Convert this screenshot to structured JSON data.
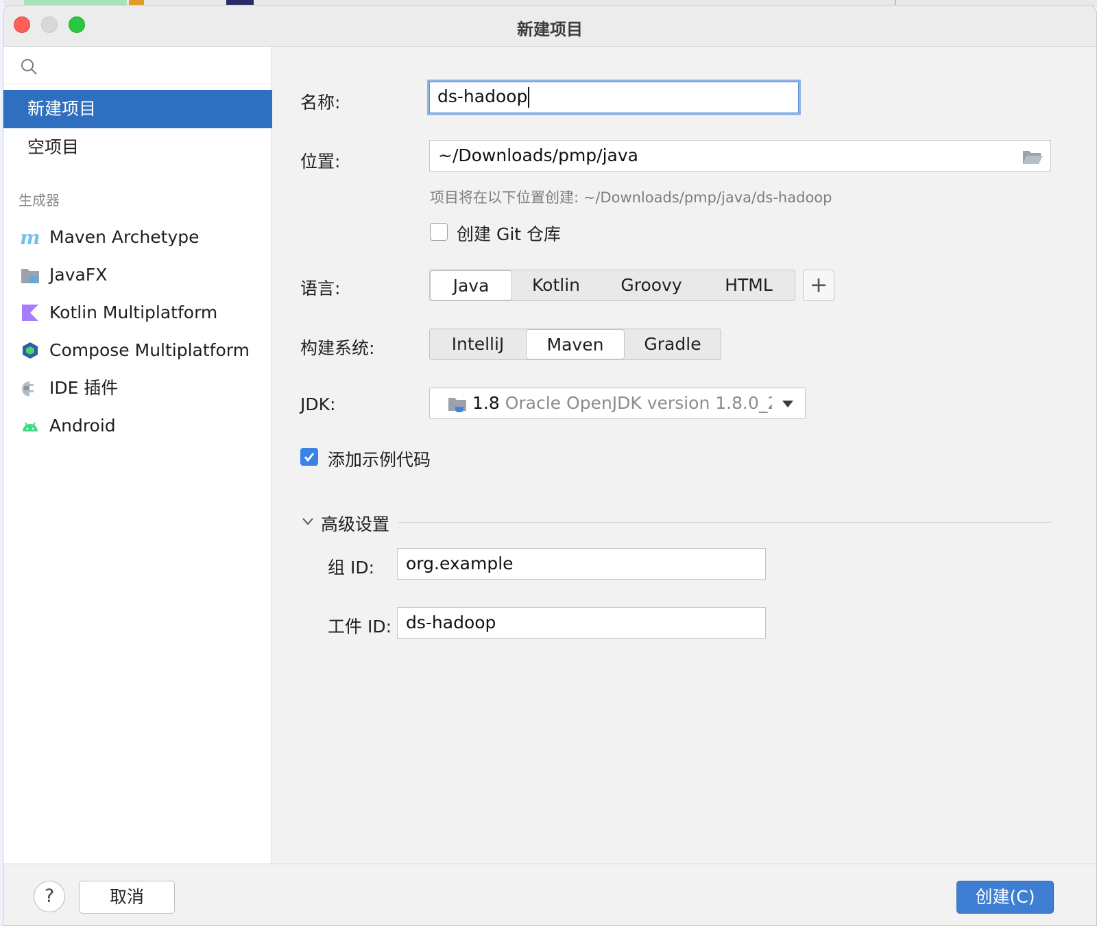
{
  "window": {
    "title": "新建项目"
  },
  "sidebar": {
    "search_placeholder": "",
    "items": [
      {
        "label": "新建项目",
        "selected": true
      },
      {
        "label": "空项目",
        "selected": false
      }
    ],
    "generators_title": "生成器",
    "generators": [
      {
        "label": "Maven Archetype",
        "icon": "maven-icon"
      },
      {
        "label": "JavaFX",
        "icon": "javafx-folder-icon"
      },
      {
        "label": "Kotlin Multiplatform",
        "icon": "kotlin-icon"
      },
      {
        "label": "Compose Multiplatform",
        "icon": "compose-icon"
      },
      {
        "label": "IDE 插件",
        "icon": "plugin-icon"
      },
      {
        "label": "Android",
        "icon": "android-icon"
      }
    ]
  },
  "form": {
    "name_label": "名称:",
    "name_value": "ds-hadoop",
    "location_label": "位置:",
    "location_value": "~/Downloads/pmp/java",
    "location_hint": "项目将在以下位置创建: ~/Downloads/pmp/java/ds-hadoop",
    "git_label": "创建 Git 仓库",
    "git_checked": false,
    "language_label": "语言:",
    "languages": [
      "Java",
      "Kotlin",
      "Groovy",
      "HTML"
    ],
    "language_selected": "Java",
    "build_label": "构建系统:",
    "build_systems": [
      "IntelliJ",
      "Maven",
      "Gradle"
    ],
    "build_selected": "Maven",
    "jdk_label": "JDK:",
    "jdk_version": "1.8",
    "jdk_desc": "Oracle OpenJDK version 1.8.0_2(",
    "sample_label": "添加示例代码",
    "sample_checked": true,
    "advanced_title": "高级设置",
    "group_label": "组 ID:",
    "group_value": "org.example",
    "artifact_label": "工件 ID:",
    "artifact_value": "ds-hadoop"
  },
  "footer": {
    "help": "?",
    "cancel": "取消",
    "create": "创建(C)"
  },
  "colors": {
    "accent": "#2f6fbf",
    "create_button": "#3f7fd3",
    "checkbox_checked": "#3c82e6",
    "close": "#fe5f57",
    "zoom": "#28c940"
  }
}
